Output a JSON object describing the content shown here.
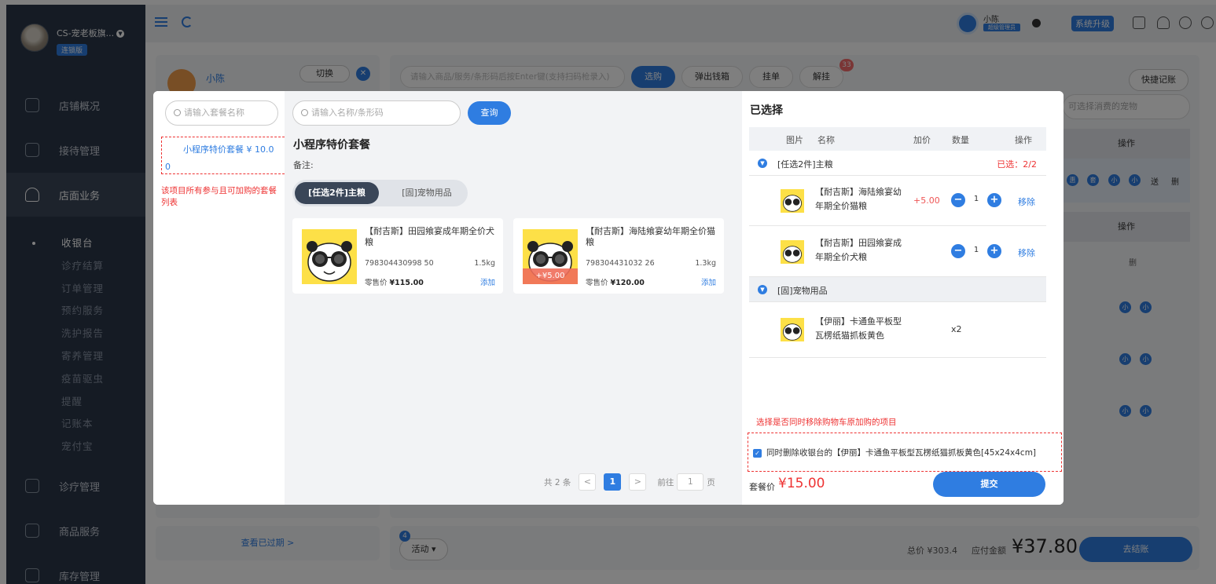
{
  "sidebar": {
    "store_name": "CS-宠老板旗...",
    "edition_badge": "连锁版",
    "nav": [
      {
        "label": "店铺概况"
      },
      {
        "label": "接待管理"
      },
      {
        "label": "店面业务"
      },
      {
        "label": "诊疗管理"
      },
      {
        "label": "商品服务"
      },
      {
        "label": "库存管理"
      }
    ],
    "sub_items": [
      "收银台",
      "诊疗结算",
      "订单管理",
      "预约服务",
      "洗护报告",
      "寄养管理",
      "疫苗驱虫",
      "提醒",
      "记账本",
      "宠付宝"
    ]
  },
  "topbar": {
    "user_name": "小陈",
    "user_role": "超级管理员",
    "upgrade_label": "系统升级"
  },
  "background": {
    "member_name": "小陈",
    "switch_label": "切换",
    "search_placeholder": "请输入商品/服务/条形码后按Enter键(支持扫码枪录入)",
    "btn_select": "选购",
    "btn_cashbox": "弹出钱箱",
    "btn_hold": "挂单",
    "btn_release": "解挂",
    "release_badge": "33",
    "quick_label": "快捷记账",
    "pet_select_placeholder": "可选择消费的宠物",
    "op_header": "操作",
    "row_chips": [
      "惠",
      "套",
      "小",
      "小"
    ],
    "row_send": "送",
    "row_del": "删",
    "op_header2": "操作",
    "del2": "删",
    "chip_small": "小",
    "view_expired": "查看已过期 >",
    "activity_badge": "4",
    "activity_label": "活动 ▾",
    "total_label": "总价 ¥303.4",
    "due_label": "应付金额",
    "due_value": "¥37.80",
    "checkout_label": "去结账"
  },
  "modal": {
    "package_search_placeholder": "请输入套餐名称",
    "package_item_name": "小程序特价套餐 ¥ 10.0",
    "package_item_wrap": "0",
    "package_note": "该项目所有参与且可加购的套餐列表",
    "item_search_placeholder": "请输入名称/条形码",
    "query_label": "查询",
    "package_title": "小程序特价套餐",
    "remark_label": "备注:",
    "segments": [
      {
        "label": "[任选2件]主粮",
        "active": true
      },
      {
        "label": "[固]宠物用品",
        "active": false
      }
    ],
    "products": [
      {
        "name": "【耐吉斯】田园飨宴成年期全价犬粮",
        "code": "798304430998 50",
        "weight": "1.5kg",
        "price_label": "零售价",
        "price": "¥115.00",
        "add": "添加",
        "tag": ""
      },
      {
        "name": "【耐吉斯】海陆飨宴幼年期全价猫粮",
        "code": "798304431032 26",
        "weight": "1.3kg",
        "price_label": "零售价",
        "price": "¥120.00",
        "add": "添加",
        "tag": "+¥5.00"
      }
    ],
    "pager": {
      "total": "共 2 条",
      "prev": "<",
      "current": "1",
      "next": ">",
      "goto": "前往",
      "goto_value": "1",
      "page_unit": "页"
    },
    "selected": {
      "title": "已选择",
      "headers": {
        "image": "图片",
        "name": "名称",
        "extra": "加价",
        "qty": "数量",
        "op": "操作"
      },
      "group1": {
        "name": "[任选2件]主粮",
        "count": "已选：2/2"
      },
      "group1_items": [
        {
          "name": "【耐吉斯】海陆飨宴幼年期全价猫粮",
          "extra": "+5.00",
          "qty": "1",
          "remove": "移除"
        },
        {
          "name": "【耐吉斯】田园飨宴成年期全价犬粮",
          "extra": "",
          "qty": "1",
          "remove": "移除"
        }
      ],
      "group2": {
        "name": "[固]宠物用品"
      },
      "group2_items": [
        {
          "name": "【伊丽】卡通鱼平板型瓦楞纸猫抓板黄色",
          "qty": "x2"
        }
      ]
    },
    "remove_hint": "选择是否同时移除购物车原加购的项目",
    "remove_checkbox_label": "同时删除收银台的【伊丽】卡通鱼平板型瓦楞纸猫抓板黄色[45x24x4cm]",
    "remove_checked": true,
    "package_price_label": "套餐价",
    "package_price": "¥15.00",
    "submit_label": "提交"
  }
}
